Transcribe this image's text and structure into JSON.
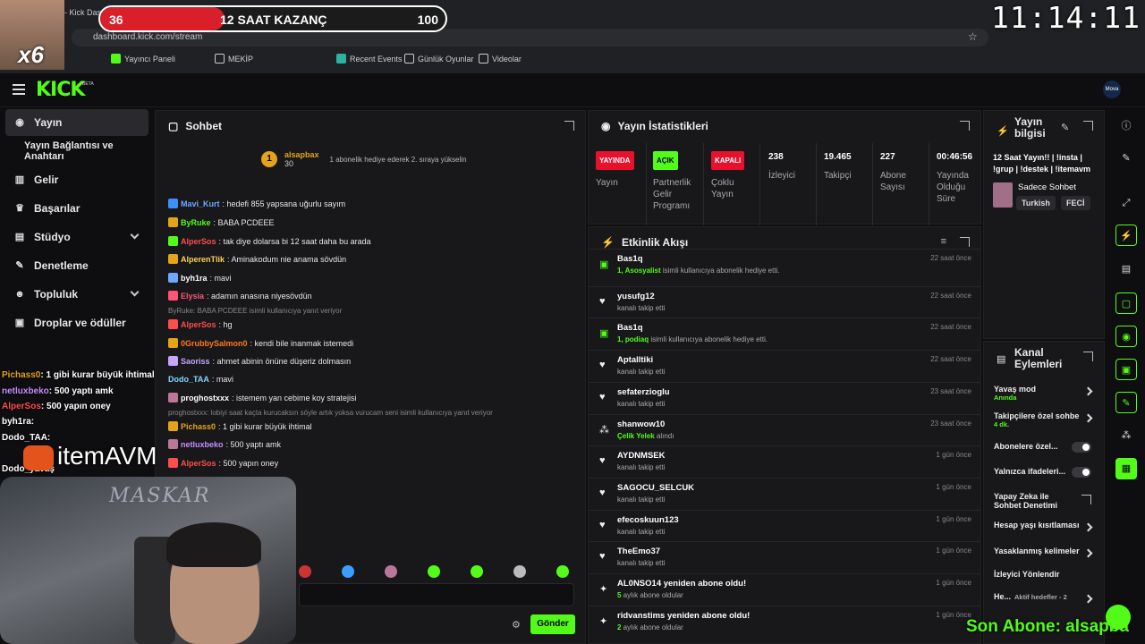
{
  "browser": {
    "url": "dashboard.kick.com/stream",
    "tab_title": "m - Kick Das",
    "bookmarks": [
      "Yayıncı Paneli",
      "MEKİP",
      "Recent Events",
      "Günlük Oyunlar",
      "Videolar"
    ]
  },
  "overlay": {
    "multiplier": "x6",
    "goal_current": "36",
    "goal_title": "12 SAAT KAZANÇ",
    "goal_max": "100",
    "goal_progress": 0.36,
    "clock": "11:14:11",
    "brand": "itemAVM",
    "cam_name": "MASKAR",
    "last_sub": "Son Abone: alsapba",
    "side_chat": [
      {
        "user": "Pichass0",
        "text": ": 1 gibi kurar büyük ihtimal",
        "color": "#e3a419"
      },
      {
        "user": "netluxbeko",
        "text": ": 500 yaptı amk",
        "color": "#c88dff"
      },
      {
        "user": "AlperSos",
        "text": ": 500 yapın oney",
        "color": "#ff4d4d"
      },
      {
        "user": "byh1ra",
        "text": ":",
        "color": "#ffffff"
      },
      {
        "user": "Dodo_TAA",
        "text": ":",
        "color": "#ffffff"
      },
      {
        "user": "",
        "text": "",
        "color": "#ffffff"
      },
      {
        "user": "Dodo_",
        "text": "yavaş",
        "color": "#ffffff"
      }
    ]
  },
  "app": {
    "logo": "KICK",
    "beta": "BETA",
    "avatar": "Mova"
  },
  "sidebar": {
    "items": [
      {
        "label": "Yayın",
        "icon": "broadcast-icon"
      },
      {
        "label": "Yayın Bağlantısı ve Anahtarı",
        "icon": ""
      },
      {
        "label": "Gelir",
        "icon": "chart-icon"
      },
      {
        "label": "Başarılar",
        "icon": "trophy-icon"
      },
      {
        "label": "Stüdyo",
        "icon": "studio-icon"
      },
      {
        "label": "Denetleme",
        "icon": "wrench-icon"
      },
      {
        "label": "Topluluk",
        "icon": "people-icon"
      },
      {
        "label": "Droplar ve ödüller",
        "icon": "gift-icon"
      }
    ]
  },
  "chat": {
    "title": "Sohbet",
    "pinned_user": "alsapbax",
    "pinned_count": "30",
    "pinned_rank": "1",
    "pinned_text": "1 abonelik hediye ederek 2. sıraya yükselin",
    "messages": [
      {
        "user": "Mavi_Kurt",
        "text": ": hedefi 855 yapsana uğurlu sayım",
        "color": "#6fa8ff"
      },
      {
        "user": "ByRuke",
        "text": ": BABA PCDEEE",
        "color": "#53fc18"
      },
      {
        "user": "AlperSos",
        "text": ": tak diye dolarsa bi 12 saat daha bu arada",
        "color": "#ff4d4d"
      },
      {
        "user": "AlperenTlik",
        "text": ": Aminakodum nie anama sövdün",
        "color": "#ffd24d"
      },
      {
        "user": "byh1ra",
        "text": ": mavi",
        "color": "#ffffff"
      },
      {
        "user": "Elysia",
        "text": ": adamın anasına niyesövdün",
        "color": "#ff5577"
      },
      {
        "user": "AlperSos",
        "text": ": hg",
        "color": "#ff4d4d"
      },
      {
        "user": "0GrubbySalmon0",
        "text": ": kendi bile inanmak istemedi",
        "color": "#ff7a1a"
      },
      {
        "user": "Saoriss",
        "text": ": ahmet abinin önüne düşeriz dolmasın",
        "color": "#c6a4ff"
      },
      {
        "user": "Dodo_TAA",
        "text": ": mavi",
        "color": "#7fd7ff"
      },
      {
        "user": "proghostxxx",
        "text": ": istemem yan cebime koy stratejisi",
        "color": "#ffffff"
      },
      {
        "user": "Pichass0",
        "text": ": 1 gibi kurar büyük ihtimal",
        "color": "#e3a419"
      },
      {
        "user": "netluxbeko",
        "text": ": 500 yaptı amk",
        "color": "#c88dff"
      },
      {
        "user": "AlperSos",
        "text": ": 500 yapın oney",
        "color": "#ff4d4d"
      }
    ],
    "reply_1": "ByRuke: BABA PCDEEE isimli kullanıcıya yanıt veriyor",
    "reply_2": "proghostxxx: lobiyi saat kaçta kurucaksın söyle artık yoksa vurucam seni isimli kullanıcıya yanıt veriyor",
    "send_label": "Gönder"
  },
  "stats": {
    "title": "Yayın İstatistikleri",
    "items": [
      {
        "tag": "YAYINDA",
        "label": "Yayın"
      },
      {
        "tag": "AÇIK",
        "label": "Partnerlik Gelir Programı"
      },
      {
        "tag": "KAPALI",
        "label": "Çoklu Yayın"
      },
      {
        "value": "238",
        "label": "İzleyici"
      },
      {
        "value": "19.465",
        "label": "Takipçi"
      },
      {
        "value": "227",
        "label": "Abone Sayısı"
      },
      {
        "value": "00:46:56",
        "label": "Yayında Olduğu Süre"
      }
    ]
  },
  "events": {
    "title": "Etkinlik Akışı",
    "items": [
      {
        "name": "Bas1q",
        "desc_hl": "1, Asosyalist",
        "desc": " isimli kullanıcıya abonelik hediye etti.",
        "time": "22 saat önce",
        "icon": "gift-icon"
      },
      {
        "name": "yusufg12",
        "desc_hl": "",
        "desc": "kanalı takip etti",
        "time": "22 saat önce",
        "icon": "heart-icon"
      },
      {
        "name": "Bas1q",
        "desc_hl": "1, podiaq",
        "desc": " isimli kullanıcıya abonelik hediye etti.",
        "time": "22 saat önce",
        "icon": "gift-icon"
      },
      {
        "name": "Aptalltiki",
        "desc_hl": "",
        "desc": "kanalı takip etti",
        "time": "22 saat önce",
        "icon": "heart-icon"
      },
      {
        "name": "sefaterzioglu",
        "desc_hl": "",
        "desc": "kanalı takip etti",
        "time": "23 saat önce",
        "icon": "heart-icon"
      },
      {
        "name": "shanwow10",
        "desc_hl": "Çelik Yelek",
        "desc": " alındı",
        "time": "23 saat önce",
        "icon": "dots-icon"
      },
      {
        "name": "AYDNMSEK",
        "desc_hl": "",
        "desc": "kanalı takip etti",
        "time": "1 gün önce",
        "icon": "heart-icon"
      },
      {
        "name": "SAGOCU_SELCUK",
        "desc_hl": "",
        "desc": "kanalı takip etti",
        "time": "1 gün önce",
        "icon": "heart-icon"
      },
      {
        "name": "efecoskuun123",
        "desc_hl": "",
        "desc": "kanalı takip etti",
        "time": "1 gün önce",
        "icon": "heart-icon"
      },
      {
        "name": "TheEmo37",
        "desc_hl": "",
        "desc": "kanalı takip etti",
        "time": "1 gün önce",
        "icon": "heart-icon"
      },
      {
        "name": "AL0NSO14 yeniden abone oldu!",
        "desc_hl": "5",
        "desc": " aylık abone oldular",
        "time": "1 gün önce",
        "icon": "star-icon"
      },
      {
        "name": "ridvanstims yeniden abone oldu!",
        "desc_hl": "2",
        "desc": " aylık abone oldular",
        "time": "1 gün önce",
        "icon": "star-icon"
      }
    ]
  },
  "info": {
    "title": "Yayın bilgisi",
    "stream_title": "12 Saat Yayın!! | !insta | !grup | !destek | !itemavm",
    "category": "Sadece Sohbet",
    "tags": [
      "Turkish",
      "FECİ"
    ]
  },
  "actions": {
    "title": "Kanal Eylemleri",
    "items": [
      {
        "label": "Yavaş mod",
        "sub": "Anında",
        "control": "arrow"
      },
      {
        "label": "Takipçilere özel sohbe",
        "sub": "4 dk.",
        "control": "arrow"
      },
      {
        "label": "Abonelere özel...",
        "sub": "",
        "control": "toggle"
      },
      {
        "label": "Yalnızca ifadeleri...",
        "sub": "",
        "control": "toggle"
      },
      {
        "label": "Yapay Zeka ile Sohbet Denetimi",
        "sub": "",
        "control": "ext"
      },
      {
        "label": "Hesap yaşı kısıtlaması",
        "sub": "",
        "control": "arrow"
      },
      {
        "label": "Yasaklanmış kelimeler",
        "sub": "",
        "control": "arrow"
      },
      {
        "label": "İzleyici Yönlendir",
        "sub": "",
        "control": ""
      },
      {
        "label": "He...",
        "sub": "Aktif hedefler - 2",
        "control": "arrow"
      }
    ]
  },
  "colors": {
    "accent": "#53fc18",
    "live": "#e8112d",
    "panel": "#18181b"
  }
}
